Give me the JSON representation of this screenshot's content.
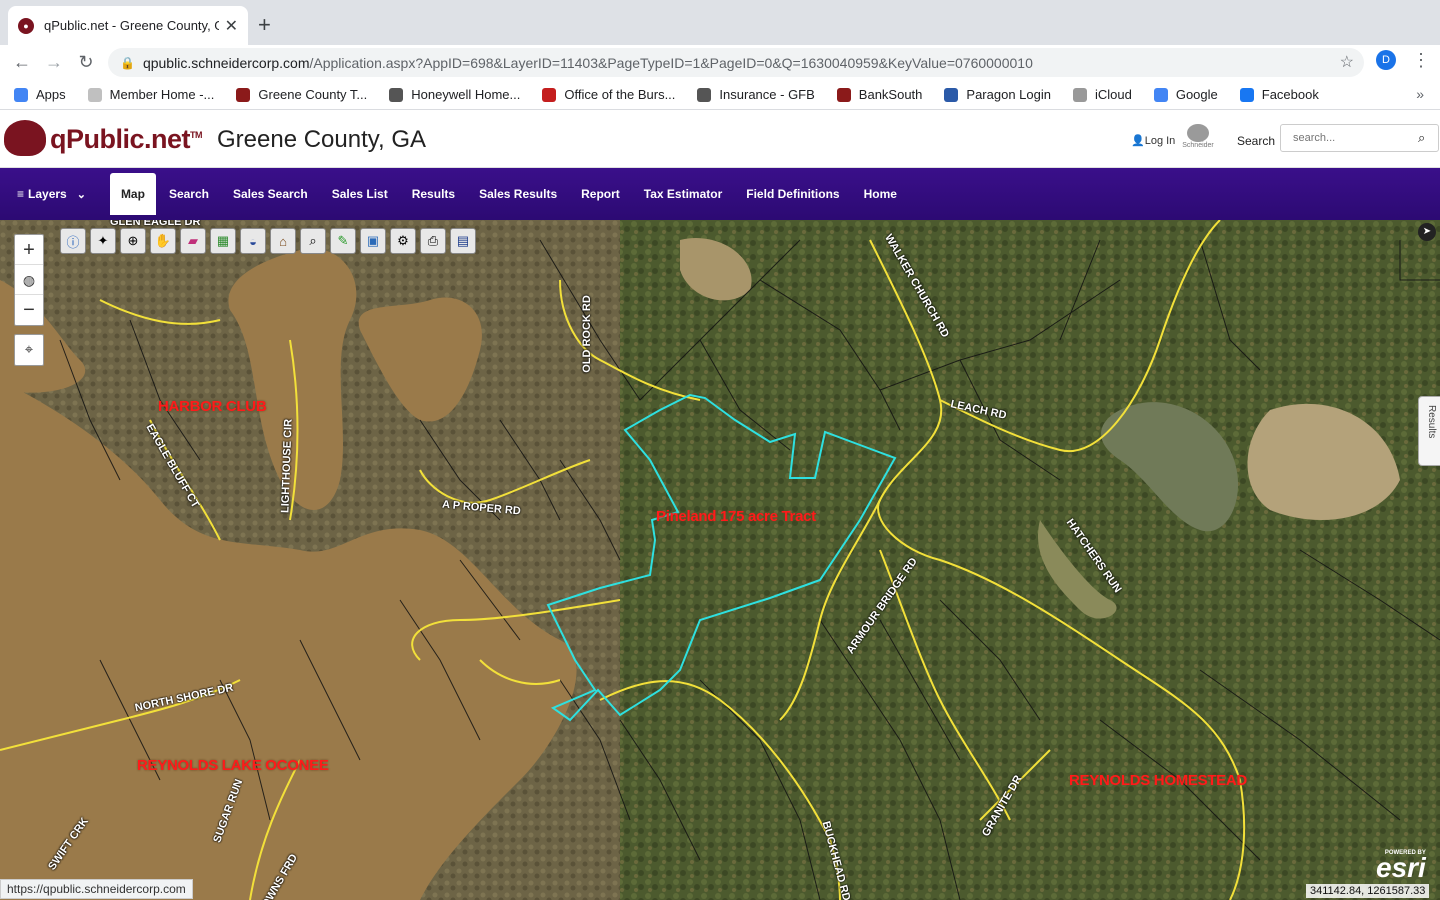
{
  "browser": {
    "tab_title": "qPublic.net - Greene County, G",
    "tab_close": "✕",
    "new_tab": "+",
    "url_host": "qpublic.schneidercorp.com",
    "url_path": "/Application.aspx?AppID=698&LayerID=11403&PageTypeID=1&PageID=0&Q=1630040959&KeyValue=0760000010",
    "profile_initial": "D",
    "bookmarks": [
      {
        "label": "Apps",
        "color": "#4285f4"
      },
      {
        "label": "Member Home -...",
        "color": "#c0c0c0"
      },
      {
        "label": "Greene County T...",
        "color": "#8b1a1a"
      },
      {
        "label": "Honeywell Home...",
        "color": "#555555"
      },
      {
        "label": "Office of the Burs...",
        "color": "#c41e1e"
      },
      {
        "label": "Insurance - GFB",
        "color": "#555555"
      },
      {
        "label": "BankSouth",
        "color": "#8b1a1a"
      },
      {
        "label": "Paragon Login",
        "color": "#2b5aa8"
      },
      {
        "label": "iCloud",
        "color": "#999999"
      },
      {
        "label": "Google",
        "color": "#4285f4"
      },
      {
        "label": "Facebook",
        "color": "#1877f2"
      }
    ],
    "more_bookmarks": "»",
    "status_url": "https://qpublic.schneidercorp.com"
  },
  "header": {
    "logo_text": "qPublic.net",
    "logo_tm": "TM",
    "county": "Greene County, GA",
    "login": "Log In",
    "schneider": "Schneider",
    "search_label": "Search",
    "search_placeholder": "search..."
  },
  "nav": {
    "items": [
      "Layers",
      "Map",
      "Search",
      "Sales Search",
      "Sales List",
      "Results",
      "Sales Results",
      "Report",
      "Tax Estimator",
      "Field Definitions",
      "Home"
    ],
    "active": "Map"
  },
  "map": {
    "area_labels": {
      "harbor": "HARBOR CLUB",
      "tract": "Pineland 175 acre Tract",
      "reynolds_lake": "REYNOLDS LAKE OCONEE",
      "homestead": "REYNOLDS HOMESTEAD"
    },
    "roads": {
      "glen_eagle": "GLEN EAGLE DR",
      "old_rock": "OLD ROCK RD",
      "walker_church": "WALKER CHURCH RD",
      "leach": "LEACH RD",
      "ap_roper": "A P ROPER RD",
      "lighthouse": "LIGHTHOUSE CIR",
      "eagle_bluff": "EAGLE BLUFF CT",
      "hatchers": "HATCHERS RUN",
      "armour_bridge": "ARMOUR BRIDGE RD",
      "north_shore": "NORTH SHORE DR",
      "sugar_run": "SUGAR RUN",
      "swift_crk": "SWIFT CRK",
      "buckhead": "BUCKHEAD RD",
      "granite": "GRANITE DR",
      "owns_frd": "OWNS FRD"
    },
    "results_tab": "Results",
    "coords": "341142.84, 1261587.33",
    "esri_powered": "POWERED BY",
    "esri_brand": "esri",
    "colors": {
      "parcel_outline": "#2ee0e0",
      "area_label": "#ff1a1a",
      "road": "#f2e03a",
      "water": "#9a7a4a",
      "forest": "#4c5a2e"
    }
  }
}
